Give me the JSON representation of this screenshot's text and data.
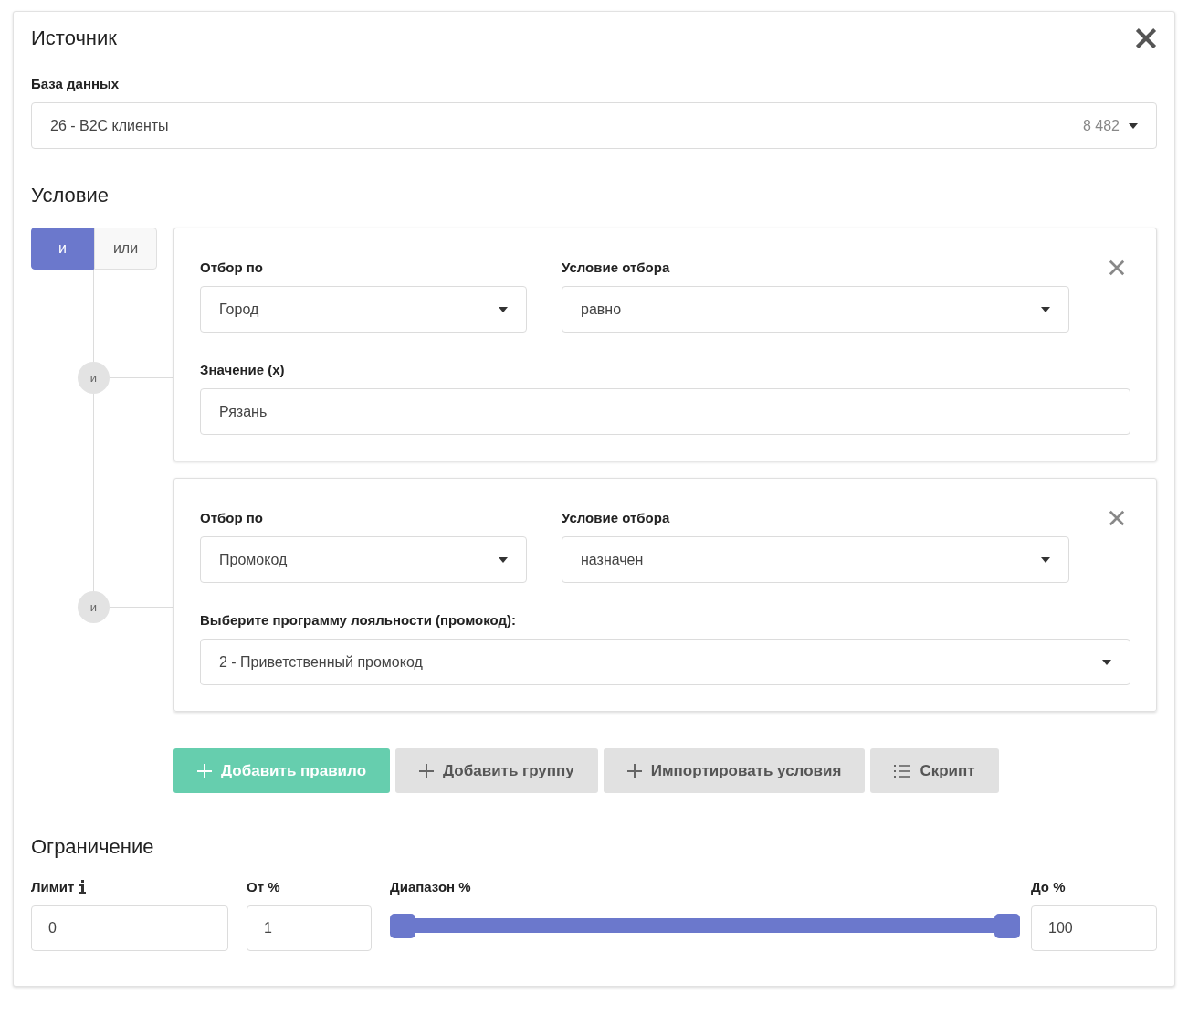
{
  "source": {
    "title": "Источник",
    "database": {
      "label": "База данных",
      "value": "26 - B2C клиенты",
      "count": "8 482"
    }
  },
  "condition": {
    "title": "Условие",
    "logic": [
      {
        "label": "и",
        "selected": true
      },
      {
        "label": "или",
        "selected": false
      }
    ],
    "rules": [
      {
        "connector": "и",
        "field_label": "Отбор по",
        "field_value": "Город",
        "operator_label": "Условие отбора",
        "operator_value": "равно",
        "value_label": "Значение (x)",
        "value": "Рязань",
        "kind": "text"
      },
      {
        "connector": "и",
        "field_label": "Отбор по",
        "field_value": "Промокод",
        "operator_label": "Условие отбора",
        "operator_value": "назначен",
        "value_label": "Выберите программу лояльности (промокод):",
        "value": "2 - Приветственный промокод",
        "kind": "select"
      }
    ],
    "buttons": [
      {
        "label": "Добавить правило",
        "kind": "primary"
      },
      {
        "label": "Добавить группу",
        "kind": "secondary"
      },
      {
        "label": "Импортировать условия",
        "kind": "secondary"
      },
      {
        "label": "Скрипт",
        "kind": "script"
      }
    ]
  },
  "limit": {
    "title": "Ограничение",
    "limit_label": "Лимит",
    "limit_value": "0",
    "from_label": "От %",
    "from_value": "1",
    "range_label": "Диапазон %",
    "range_thumbs": [
      {
        "level": 0
      },
      {
        "level": 1
      }
    ],
    "to_label": "До %",
    "to_value": "100"
  }
}
